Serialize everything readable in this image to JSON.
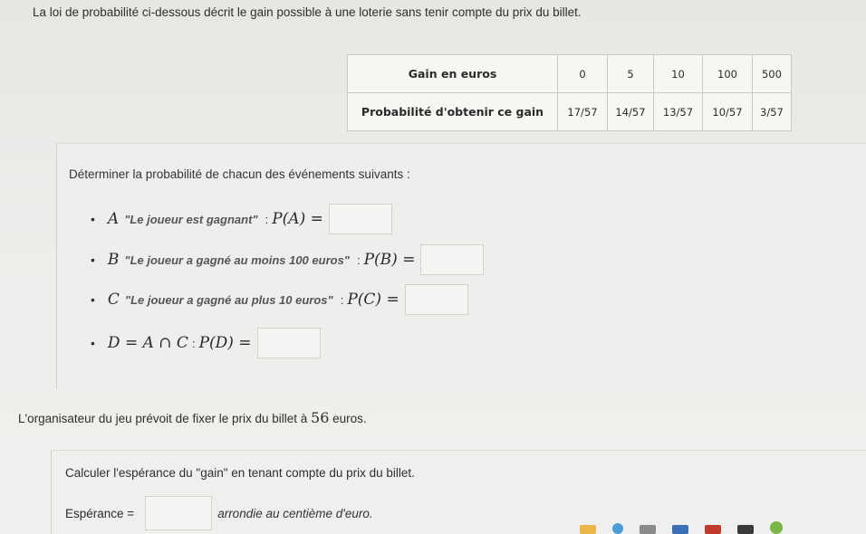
{
  "intro": "La loi de probabilité ci-dessous décrit le gain possible à une loterie sans tenir compte du prix du billet.",
  "table": {
    "row1_header": "Gain en euros",
    "gains": [
      "0",
      "5",
      "10",
      "100",
      "500"
    ],
    "row2_header": "Probabilité d'obtenir ce gain",
    "probas": [
      "17/57",
      "14/57",
      "13/57",
      "10/57",
      "3/57"
    ]
  },
  "question": "Déterminer la probabilité de chacun des événements suivants :",
  "events": [
    {
      "letter": "A",
      "text": "\"Le joueur est gagnant\"",
      "sep": ":",
      "prob": "P(A) ="
    },
    {
      "letter": "B",
      "text": "\"Le joueur a gagné au moins 100 euros\"",
      "sep": ":",
      "prob": "P(B) ="
    },
    {
      "letter": "C",
      "text": "\"Le joueur a gagné au plus 10 euros\"",
      "sep": ":",
      "prob": "P(C) ="
    },
    {
      "letter": "D = A ∩ C",
      "text": "",
      "sep": ":",
      "prob": "P(D) ="
    }
  ],
  "organizer": {
    "before": "L'organisateur du jeu prévoit de fixer le prix du billet à",
    "price": "56",
    "after": "euros."
  },
  "calc": "Calculer l'espérance du \"gain\" en tenant compte du prix du billet.",
  "esperance": {
    "label": "Espérance =",
    "suffix": "arrondie au centième d'euro."
  },
  "taskbar_colors": [
    "#e9b64a",
    "#4a9bd6",
    "#8a8a8a",
    "#3b6fb6",
    "#c0392b",
    "#3a3a3a",
    "#7ab648"
  ]
}
